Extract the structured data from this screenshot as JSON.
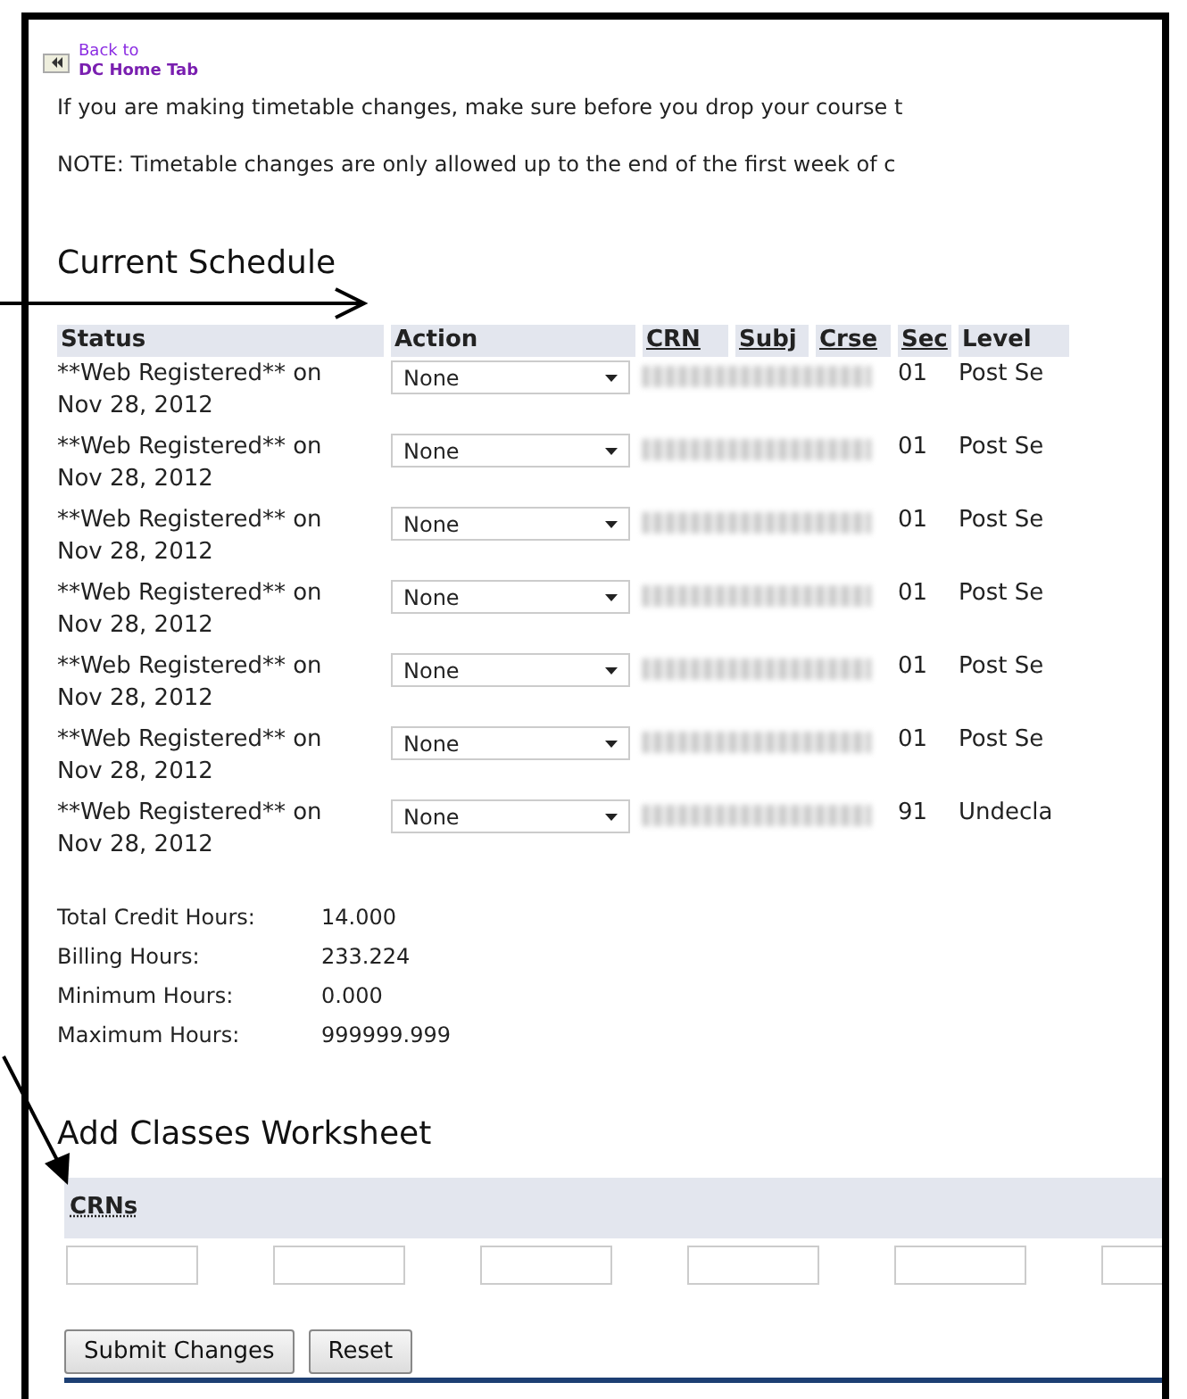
{
  "back_link": {
    "line1": "Back to",
    "line2": "DC Home Tab"
  },
  "notices": [
    "If you are making timetable changes, make sure before you drop your course t",
    "NOTE: Timetable changes are only allowed up to the end of the first week of c"
  ],
  "schedule": {
    "title": "Current Schedule",
    "columns": [
      "Status",
      "Action",
      "CRN",
      "Subj",
      "Crse",
      "Sec",
      "Level"
    ],
    "rows": [
      {
        "status": "**Web Registered** on",
        "date": "Nov 28, 2012",
        "action": "None",
        "sec": "01",
        "level": "Post Se"
      },
      {
        "status": "**Web Registered** on",
        "date": "Nov 28, 2012",
        "action": "None",
        "sec": "01",
        "level": "Post Se"
      },
      {
        "status": "**Web Registered** on",
        "date": "Nov 28, 2012",
        "action": "None",
        "sec": "01",
        "level": "Post Se"
      },
      {
        "status": "**Web Registered** on",
        "date": "Nov 28, 2012",
        "action": "None",
        "sec": "01",
        "level": "Post Se"
      },
      {
        "status": "**Web Registered** on",
        "date": "Nov 28, 2012",
        "action": "None",
        "sec": "01",
        "level": "Post Se"
      },
      {
        "status": "**Web Registered** on",
        "date": "Nov 28, 2012",
        "action": "None",
        "sec": "01",
        "level": "Post Se"
      },
      {
        "status": "**Web Registered** on",
        "date": "Nov 28, 2012",
        "action": "None",
        "sec": "91",
        "level": "Undecla"
      }
    ]
  },
  "totals": [
    {
      "label": "Total Credit Hours:",
      "value": "14.000"
    },
    {
      "label": "Billing Hours:",
      "value": "233.224"
    },
    {
      "label": "Minimum Hours:",
      "value": "0.000"
    },
    {
      "label": "Maximum Hours:",
      "value": "999999.999"
    }
  ],
  "worksheet": {
    "title": "Add Classes Worksheet",
    "column": "CRNs"
  },
  "buttons": [
    "Submit Changes",
    "Reset"
  ]
}
